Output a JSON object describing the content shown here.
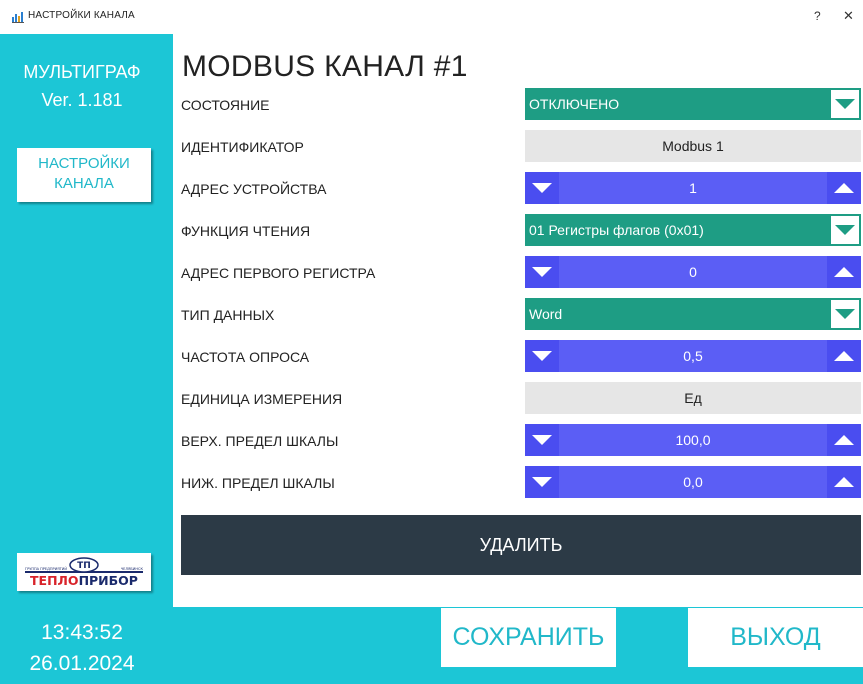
{
  "window": {
    "title": "НАСТРОЙКИ КАНАЛА",
    "help_glyph": "?",
    "close_glyph": "✕",
    "icon": "chart-app-icon"
  },
  "sidebar": {
    "app_name": "МУЛЬТИГРАФ",
    "version": "Ver. 1.181",
    "nav_item_line1": "НАСТРОЙКИ",
    "nav_item_line2": "КАНАЛА",
    "logo": {
      "main_part1": "ТЕПЛО",
      "main_part2": "ПРИБОР",
      "emblem": "ТП",
      "small_left": "ГРУППА ПРЕДПРИЯТИЙ",
      "small_right": "ЧЕЛЯБИНСК"
    },
    "time": "13:43:52",
    "date": "26.01.2024"
  },
  "main": {
    "title": "MODBUS КАНАЛ #1",
    "rows": [
      {
        "label": "СОСТОЯНИЕ",
        "type": "dropdown",
        "value": "ОТКЛЮЧЕНО"
      },
      {
        "label": "ИДЕНТИФИКАТОР",
        "type": "text",
        "value": "Modbus 1"
      },
      {
        "label": "АДРЕС УСТРОЙСТВА",
        "type": "spinner",
        "value": "1"
      },
      {
        "label": "ФУНКЦИЯ ЧТЕНИЯ",
        "type": "dropdown",
        "value": "01 Регистры флагов (0x01)"
      },
      {
        "label": "АДРЕС ПЕРВОГО РЕГИСТРА",
        "type": "spinner",
        "value": "0"
      },
      {
        "label": "ТИП ДАННЫХ",
        "type": "dropdown",
        "value": "Word"
      },
      {
        "label": "ЧАСТОТА ОПРОСА",
        "type": "spinner",
        "value": "0,5"
      },
      {
        "label": "ЕДИНИЦА ИЗМЕРЕНИЯ",
        "type": "text",
        "value": "Ед"
      },
      {
        "label": "ВЕРХ. ПРЕДЕЛ ШКАЛЫ",
        "type": "spinner",
        "value": "100,0"
      },
      {
        "label": "НИЖ. ПРЕДЕЛ ШКАЛЫ",
        "type": "spinner",
        "value": "0,0"
      }
    ],
    "delete_label": "УДАЛИТЬ",
    "save_label": "СОХРАНИТЬ",
    "exit_label": "ВЫХОД"
  },
  "colors": {
    "accent_cyan": "#1cc6d6",
    "dropdown_green": "#1e9d84",
    "spinner_blue": "#5b5ef5",
    "delete_dark": "#2c3a46",
    "readonly_gray": "#e6e6e6"
  }
}
